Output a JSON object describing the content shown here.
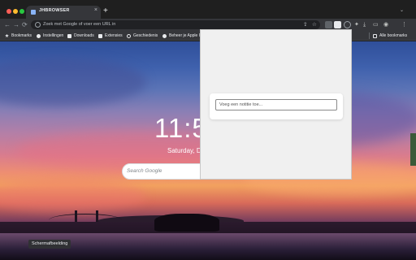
{
  "tabstrip": {
    "tab_title": "JHBROWSER",
    "tab_close": "×",
    "new_tab": "+",
    "menu": "⌄"
  },
  "toolbar": {
    "back": "←",
    "forward": "→",
    "reload": "⟳",
    "omnibox_placeholder": "Zoek met Google of voer een URL in",
    "share_glyph": "⇪",
    "star_glyph": "☆",
    "puzzle_glyph": "✦",
    "download_glyph": "⤓",
    "sidepanel_glyph": "▭",
    "profile_glyph": "◉",
    "menu_glyph": "⋮"
  },
  "bookmarks": {
    "items": [
      {
        "label": "Bookmarks",
        "icon": "star-icon",
        "color": "#e8eaed"
      },
      {
        "label": "Instellingen",
        "icon": "gear-icon",
        "color": "#e8eaed"
      },
      {
        "label": "Downloads",
        "icon": "download-icon",
        "color": "#e8eaed"
      },
      {
        "label": "Extensies",
        "icon": "puzzle-icon",
        "color": "#e8eaed"
      },
      {
        "label": "Geschiedenis",
        "icon": "history-icon",
        "color": "#e8eaed"
      },
      {
        "label": "Beheer je Apple ID",
        "icon": "apple-icon",
        "color": "#e8eaed"
      }
    ],
    "all_bookmarks": "Alle bookmarks"
  },
  "newtab": {
    "clock": "11:5",
    "date": "Saturday, De",
    "search_placeholder": "Search Google",
    "wallpaper_label": "Schermafbeelding"
  },
  "popup": {
    "input_placeholder": "Voeg een notitie toe..."
  }
}
